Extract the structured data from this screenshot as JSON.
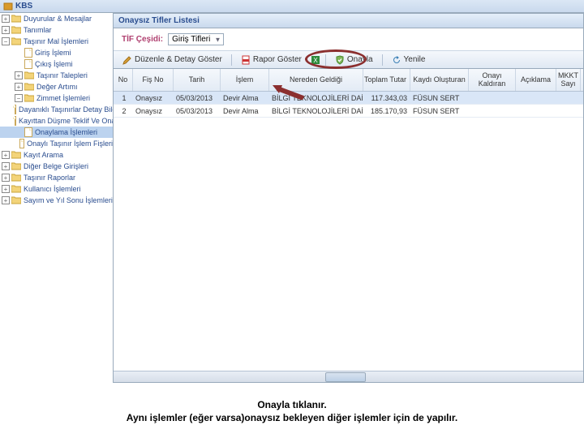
{
  "app": {
    "title": "KBS"
  },
  "sidebar": {
    "items": [
      {
        "label": "Duyurular & Mesajlar",
        "type": "folder",
        "level": 1,
        "toggle": "+"
      },
      {
        "label": "Tanımlar",
        "type": "folder",
        "level": 1,
        "toggle": "+"
      },
      {
        "label": "Taşınır Mal İşlemleri",
        "type": "folder",
        "level": 1,
        "toggle": "−"
      },
      {
        "label": "Giriş İşlemi",
        "type": "file",
        "level": 2
      },
      {
        "label": "Çıkış İşlemi",
        "type": "file",
        "level": 2
      },
      {
        "label": "Taşınır Talepleri",
        "type": "folder",
        "level": 2,
        "toggle": "+"
      },
      {
        "label": "Değer Artımı",
        "type": "folder",
        "level": 2,
        "toggle": "+"
      },
      {
        "label": "Zimmet İşlemleri",
        "type": "folder",
        "level": 2,
        "toggle": "−"
      },
      {
        "label": "Dayanıklı Taşınırlar Detay Bilgileri",
        "type": "file",
        "level": 2
      },
      {
        "label": "Kayıttan Düşme Teklif Ve Onay Tutanağı",
        "type": "file",
        "level": 2
      },
      {
        "label": "Onaylama İşlemleri",
        "type": "file",
        "level": 2,
        "selected": true
      },
      {
        "label": "Onaylı Taşınır İşlem Fişleri",
        "type": "file",
        "level": 2
      },
      {
        "label": "Kayıt Arama",
        "type": "folder",
        "level": 1,
        "toggle": "+"
      },
      {
        "label": "Diğer Belge Girişleri",
        "type": "folder",
        "level": 1,
        "toggle": "+"
      },
      {
        "label": "Taşınır Raporlar",
        "type": "folder",
        "level": 1,
        "toggle": "+"
      },
      {
        "label": "Kullanıcı İşlemleri",
        "type": "folder",
        "level": 1,
        "toggle": "+"
      },
      {
        "label": "Sayım ve Yıl Sonu İşlemleri",
        "type": "folder",
        "level": 1,
        "toggle": "+"
      }
    ]
  },
  "panel": {
    "title": "Onaysız Tifler Listesi"
  },
  "filter": {
    "label": "TİF Çeşidi:",
    "value": "Giriş Tifleri"
  },
  "toolbar": {
    "edit": "Düzenle & Detay Göster",
    "rapor": "Rapor Göster",
    "onayla": "Onayla",
    "yenile": "Yenile"
  },
  "grid": {
    "headers": {
      "no": "No",
      "fis": "Fiş No",
      "tarih": "Tarih",
      "islem": "İşlem",
      "nereden": "Nereden Geldiği",
      "tutar": "Toplam Tutar",
      "olus": "Kaydı Oluşturan",
      "kaldir": "Onayı Kaldıran",
      "acik": "Açıklama",
      "sayi": "MKKT Sayı"
    },
    "rows": [
      {
        "no": "1",
        "fis": "Onaysız",
        "tarih": "05/03/2013",
        "islem": "Devir Alma",
        "nereden": "BİLGİ TEKNOLOJİLERİ DAİ...",
        "tutar": "117.343,03",
        "olus": "FÜSUN SERT",
        "kaldir": "",
        "acik": "",
        "sayi": ""
      },
      {
        "no": "2",
        "fis": "Onaysız",
        "tarih": "05/03/2013",
        "islem": "Devir Alma",
        "nereden": "BİLGİ TEKNOLOJİLERİ DAİ...",
        "tutar": "185.170,93",
        "olus": "FÜSUN SERT",
        "kaldir": "",
        "acik": "",
        "sayi": ""
      }
    ]
  },
  "caption": {
    "line1": "Onayla tıklanır.",
    "line2": "Aynı işlemler (eğer varsa)onaysız bekleyen diğer işlemler için de yapılır."
  }
}
